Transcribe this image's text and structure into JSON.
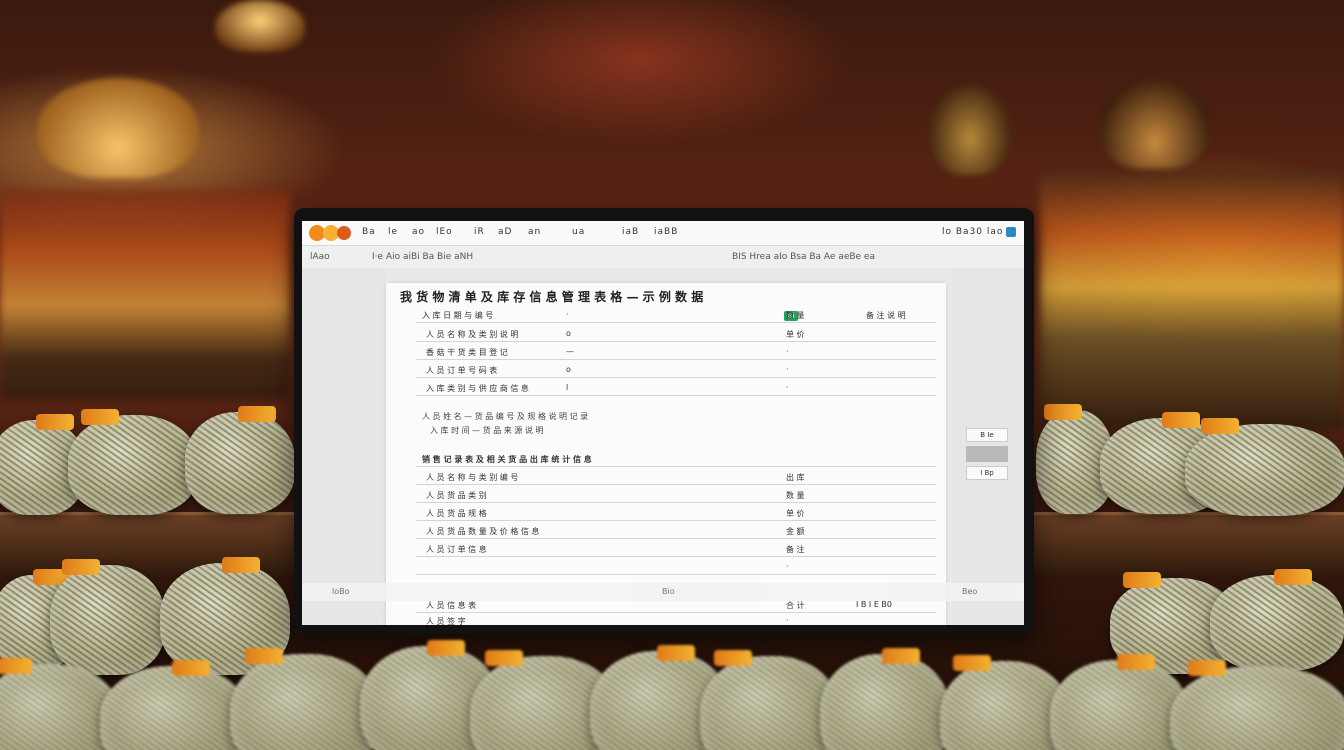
{
  "toolbar": {
    "items": [
      "Ba",
      "le",
      "ao",
      "lEo",
      "iR",
      "aD",
      "an",
      "ua",
      "iaB",
      "iaBB"
    ],
    "right_text": "lo Ba30 lao"
  },
  "subbar": {
    "left_label": "lAao",
    "mid_text": "I·e Aio aiBi Ba Bie aNH",
    "right_text": "BIS Hrea aIo Bsa Ba Ae aeBe ea"
  },
  "document": {
    "heading": "我 货 物 清 单 及 库 存 信 息 管 理 表 格 — 示 例 数 据",
    "section1": [
      {
        "a": "入 库 日 期 与 编 号",
        "b": "·",
        "c": "数 量",
        "d": "备 注 说 明"
      },
      {
        "a": "人 员 名 称 及 类 别 说 明",
        "b": "o",
        "c": "单 价",
        "d": ""
      },
      {
        "a": "香 菇 干 货 类 目 登 记",
        "b": "—",
        "c": "·",
        "d": ""
      },
      {
        "a": "人 员 订 单 号 码 表",
        "b": "o",
        "c": "·",
        "d": ""
      },
      {
        "a": "入 库 类 别 与 供 应 商 信 息",
        "b": "l",
        "c": "·",
        "d": ""
      }
    ],
    "notes": [
      "人 员 姓 名 — 货 品 编 号 及 规 格 说 明 记 录",
      "入 库 时 间 — 货 品 来 源 说 明"
    ],
    "section2_header": "销 售 记 录 表 及 相 关 货 品 出 库 统 计 信 息",
    "section2": [
      {
        "a": "人 员 名 称 与 类 别 编 号",
        "c": "出 库"
      },
      {
        "a": "人 员 货 品 类 别",
        "c": "数 量"
      },
      {
        "a": "人 员 货 品 规 格",
        "c": "单 价"
      },
      {
        "a": "人 员 货 品 数 量 及 价 格 信 息",
        "c": "金 额"
      },
      {
        "a": "人 员 订 单 信 息",
        "c": "备 注"
      },
      {
        "a": "",
        "c": "·"
      }
    ],
    "section3": [
      {
        "a": "人 员 信 息 表",
        "c": "合 计",
        "d": "I B I E B0"
      },
      {
        "a": "人 员 签 字",
        "c": "·",
        "d": ""
      }
    ],
    "tag_label": "Bi"
  },
  "right_panel": {
    "btn1": "B Ie",
    "btn2": "I Bp"
  },
  "bottom_strip": {
    "left_text": "loBo",
    "mid_text": "Bio",
    "right_text": "Beo"
  },
  "colors": {
    "wall": "#6b2a16",
    "counter": "#4b2b17",
    "bag_tag": "#f2b230",
    "screen_bg": "#e9e9ea",
    "accent_tag": "#26a35a"
  }
}
